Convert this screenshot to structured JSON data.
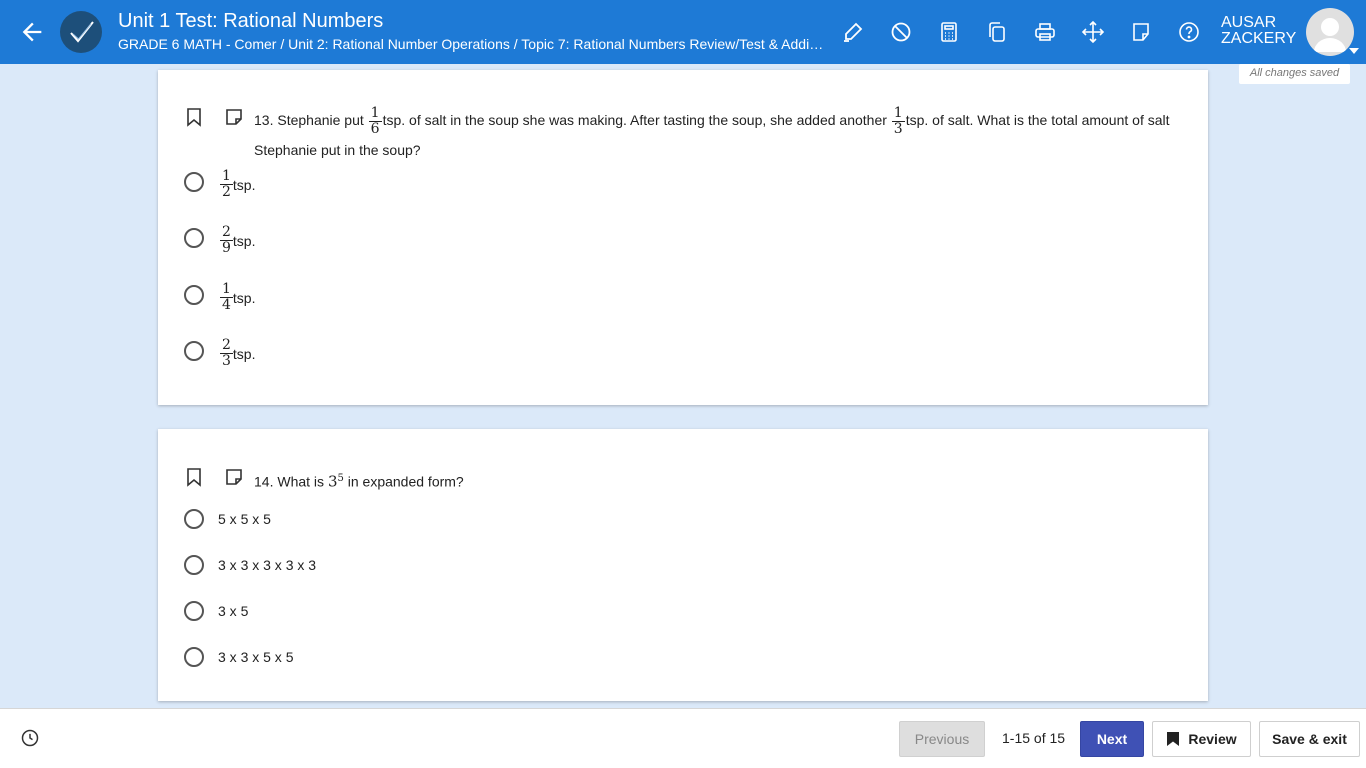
{
  "header": {
    "title": "Unit 1 Test: Rational Numbers",
    "breadcrumb": "GRADE 6 MATH - Comer / Unit 2: Rational Number Operations / Topic 7: Rational Numbers Review/Test & Adding ...",
    "user_first": "AUSAR",
    "user_last": "ZACKERY",
    "save_status": "All changes saved",
    "tools": [
      "highlighter-icon",
      "eliminator-icon",
      "calculator-icon",
      "copy-icon",
      "print-icon",
      "move-icon",
      "note-icon",
      "help-icon"
    ]
  },
  "questions": [
    {
      "number": "13.",
      "text_a": "Stephanie put",
      "frac1": {
        "num": "1",
        "den": "6"
      },
      "text_b": "tsp. of salt in the soup she was making. After tasting the soup, she added another",
      "frac2": {
        "num": "1",
        "den": "3"
      },
      "text_c": "tsp. of salt. What is the total amount of salt Stephanie put in the soup?",
      "options": [
        {
          "num": "1",
          "den": "2",
          "unit": "tsp."
        },
        {
          "num": "2",
          "den": "9",
          "unit": "tsp."
        },
        {
          "num": "1",
          "den": "4",
          "unit": "tsp."
        },
        {
          "num": "2",
          "den": "3",
          "unit": "tsp."
        }
      ]
    },
    {
      "number": "14.",
      "text_a": "What is",
      "base": "3",
      "exponent": "5",
      "text_b": "in expanded form?",
      "options": [
        "5 x 5 x 5",
        "3 x 3 x 3 x 3 x 3",
        "3 x 5",
        "3 x 3 x 5 x 5"
      ]
    }
  ],
  "footer": {
    "previous": "Previous",
    "page_count": "1-15 of 15",
    "next": "Next",
    "review": "Review",
    "save_exit": "Save & exit"
  },
  "colors": {
    "header_bg": "#1e7ad6",
    "page_bg": "#dbe9f9",
    "next_button": "#3f51b5"
  }
}
